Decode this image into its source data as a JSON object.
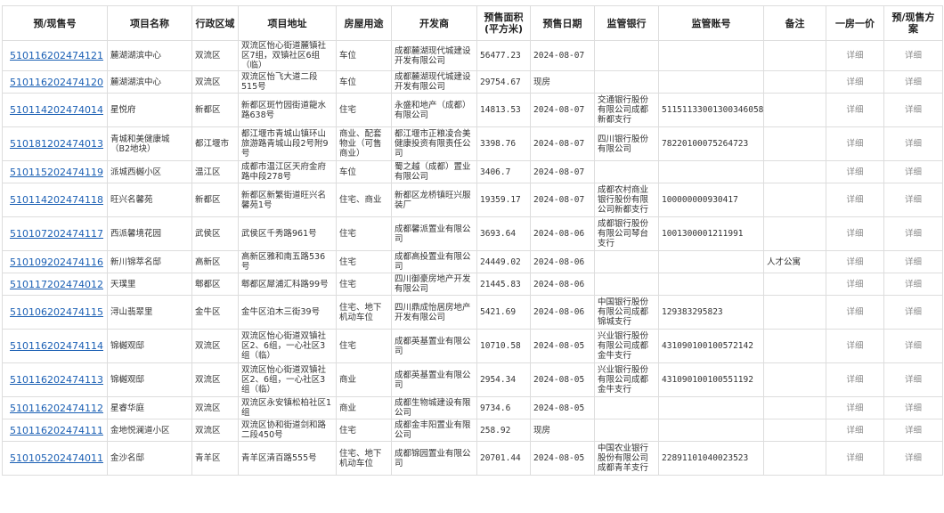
{
  "headers": [
    "预/现售号",
    "项目名称",
    "行政区域",
    "项目地址",
    "房屋用途",
    "开发商",
    "预售面积(平方米)",
    "预售日期",
    "监管银行",
    "监管账号",
    "备注",
    "一房一价",
    "预/现售方案"
  ],
  "detail_label": "详细",
  "rows": [
    {
      "permit": "510116202474121",
      "project": "麓湖湖滨中心",
      "district": "双流区",
      "address": "双流区怡心街道麓镇社区7组，双镇社区6组（临）",
      "use": "车位",
      "developer": "成都麓湖现代城建设开发有限公司",
      "area": "56477.23",
      "date": "2024-08-07",
      "bank": "",
      "account": "",
      "note": ""
    },
    {
      "permit": "510116202474120",
      "project": "麓湖湖滨中心",
      "district": "双流区",
      "address": "双流区怡飞大道二段515号",
      "use": "车位",
      "developer": "成都麓湖现代城建设开发有限公司",
      "area": "29754.67",
      "date": "现房",
      "bank": "",
      "account": "",
      "note": ""
    },
    {
      "permit": "510114202474014",
      "project": "星悦府",
      "district": "新都区",
      "address": "新都区斑竹园街道龍水路638号",
      "use": "住宅",
      "developer": "永盛和地产（成都）有限公司",
      "area": "14813.53",
      "date": "2024-08-07",
      "bank": "交通银行股份有限公司成都新都支行",
      "account": "511511330013003460583",
      "note": ""
    },
    {
      "permit": "510181202474013",
      "project": "青城和美健康城（B2地块）",
      "district": "都江堰市",
      "address": "都江堰市青城山镇环山旅游路青城山段2号附9号",
      "use": "商业、配套物业（可售商业）",
      "developer": "都江堰市正粮凌合美健康投资有限责任公司",
      "area": "3398.76",
      "date": "2024-08-07",
      "bank": "四川银行股份有限公司",
      "account": "78220100075264723",
      "note": ""
    },
    {
      "permit": "510115202474119",
      "project": "派城西樾小区",
      "district": "温江区",
      "address": "成都市温江区天府金府路中段278号",
      "use": "车位",
      "developer": "蜀之越（成都）置业有限公司",
      "area": "3406.7",
      "date": "2024-08-07",
      "bank": "",
      "account": "",
      "note": ""
    },
    {
      "permit": "510114202474118",
      "project": "旺兴名馨苑",
      "district": "新都区",
      "address": "新都区新繁街道旺兴名馨苑1号",
      "use": "住宅、商业",
      "developer": "新都区龙桥镇旺兴服装厂",
      "area": "19359.17",
      "date": "2024-08-07",
      "bank": "成都农村商业银行股份有限公司新都支行",
      "account": "100000000930417",
      "note": ""
    },
    {
      "permit": "510107202474117",
      "project": "西派馨境花园",
      "district": "武侯区",
      "address": "武侯区千秀路961号",
      "use": "住宅",
      "developer": "成都馨派置业有限公司",
      "area": "3693.64",
      "date": "2024-08-06",
      "bank": "成都银行股份有限公司琴台支行",
      "account": "1001300001211991",
      "note": ""
    },
    {
      "permit": "510109202474116",
      "project": "新川锦萃名邸",
      "district": "高新区",
      "address": "高新区雅和南五路536号",
      "use": "住宅",
      "developer": "成都高投置业有限公司",
      "area": "24449.02",
      "date": "2024-08-06",
      "bank": "",
      "account": "",
      "note": "人才公寓"
    },
    {
      "permit": "510117202474012",
      "project": "天璞里",
      "district": "郫都区",
      "address": "郫都区犀浦汇科路99号",
      "use": "住宅",
      "developer": "四川御豪房地产开发有限公司",
      "area": "21445.83",
      "date": "2024-08-06",
      "bank": "",
      "account": "",
      "note": ""
    },
    {
      "permit": "510106202474115",
      "project": "浔山翡翠里",
      "district": "金牛区",
      "address": "金牛区泊木三街39号",
      "use": "住宅、地下机动车位",
      "developer": "四川鼎成怡居房地产开发有限公司",
      "area": "5421.69",
      "date": "2024-08-06",
      "bank": "中国银行股份有限公司成都锦城支行",
      "account": "129383295823",
      "note": ""
    },
    {
      "permit": "510116202474114",
      "project": "锦樾观邸",
      "district": "双流区",
      "address": "双流区怡心街道双镇社区2、6组，一心社区3组（临）",
      "use": "住宅",
      "developer": "成都英基置业有限公司",
      "area": "10710.58",
      "date": "2024-08-05",
      "bank": "兴业银行股份有限公司成都金牛支行",
      "account": "431090100100572142",
      "note": ""
    },
    {
      "permit": "510116202474113",
      "project": "锦樾观邸",
      "district": "双流区",
      "address": "双流区怡心街道双镇社区2、6组，一心社区3组（临）",
      "use": "商业",
      "developer": "成都英基置业有限公司",
      "area": "2954.34",
      "date": "2024-08-05",
      "bank": "兴业银行股份有限公司成都金牛支行",
      "account": "431090100100551192",
      "note": ""
    },
    {
      "permit": "510116202474112",
      "project": "星睿华庭",
      "district": "双流区",
      "address": "双流区永安镇松柏社区1组",
      "use": "商业",
      "developer": "成都生物城建设有限公司",
      "area": "9734.6",
      "date": "2024-08-05",
      "bank": "",
      "account": "",
      "note": ""
    },
    {
      "permit": "510116202474111",
      "project": "金地悦澜道小区",
      "district": "双流区",
      "address": "双流区协和街道剑和路二段450号",
      "use": "住宅",
      "developer": "成都金丰阳置业有限公司",
      "area": "258.92",
      "date": "现房",
      "bank": "",
      "account": "",
      "note": ""
    },
    {
      "permit": "510105202474011",
      "project": "金沙名邸",
      "district": "青羊区",
      "address": "青羊区清百路555号",
      "use": "住宅、地下机动车位",
      "developer": "成都锦园置业有限公司",
      "area": "20701.44",
      "date": "2024-08-05",
      "bank": "中国农业银行股份有限公司成都青羊支行",
      "account": "22891101040023523",
      "note": ""
    }
  ]
}
